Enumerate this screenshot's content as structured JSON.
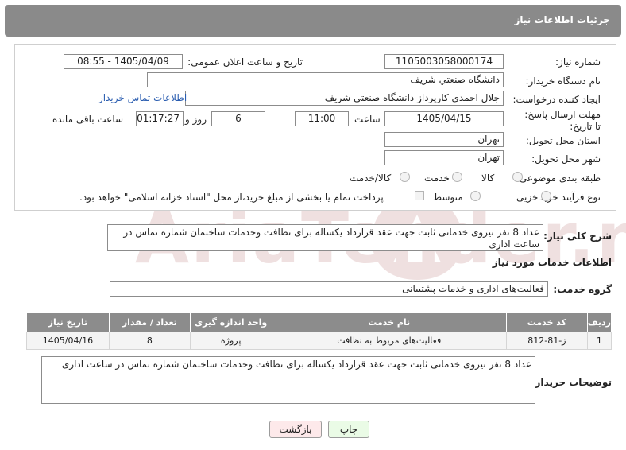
{
  "header": {
    "title": "جزئیات اطلاعات نیاز"
  },
  "form": {
    "need_number": {
      "label": "شماره نیاز:",
      "value": "1105003058000174"
    },
    "announce_datetime": {
      "label": "تاریخ و ساعت اعلان عمومی:",
      "value": "1405/04/09 - 08:55"
    },
    "buyer_org": {
      "label": "نام دستگاه خریدار:",
      "value": "دانشگاه صنعتي شريف"
    },
    "requester": {
      "label": "ایجاد کننده درخواست:",
      "value": "جلال احمدی کارپرداز دانشگاه صنعتي شريف",
      "contact_link": "اطلاعات تماس خریدار"
    },
    "deadline": {
      "label": "مهلت ارسال پاسخ: تا تاریخ:",
      "date": "1405/04/15",
      "time_label": "ساعت",
      "time": "11:00",
      "days": "6",
      "days_label": "روز و",
      "remaining": "01:17:27",
      "remaining_label": "ساعت باقی مانده"
    },
    "province": {
      "label": "استان محل تحویل:",
      "value": "تهران"
    },
    "city": {
      "label": "شهر محل تحویل:",
      "value": "تهران"
    },
    "category": {
      "label": "طبقه بندی موضوعی:",
      "options": [
        "کالا",
        "خدمت",
        "کالا/خدمت"
      ]
    },
    "process_type": {
      "label": "نوع فرآیند خرید :",
      "options": [
        "جزیی",
        "متوسط"
      ],
      "payment_note": "پرداخت تمام یا بخشی از مبلغ خرید،از محل \"اسناد خزانه اسلامی\" خواهد بود."
    }
  },
  "summary": {
    "label": "شرح کلی نیاز:",
    "value": "عداد 8 نفر نیروی خدماتی ثابت جهت عقد قرارداد یکساله برای نظافت وخدمات ساختمان شماره تماس در ساعت اداری"
  },
  "services_section": {
    "title": "اطلاعات خدمات مورد نیاز",
    "group_label": "گروه خدمت:",
    "group_value": "فعالیت‌های اداری و خدمات پشتیبانی",
    "columns": [
      "ردیف",
      "کد خدمت",
      "نام خدمت",
      "واحد اندازه گیری",
      "تعداد / مقدار",
      "تاریخ نیاز"
    ],
    "rows": [
      {
        "index": "1",
        "code": "ز-81-812",
        "name": "فعالیت‌های مربوط به نظافت",
        "unit": "پروژه",
        "qty": "8",
        "date": "1405/04/16"
      }
    ]
  },
  "buyer_notes": {
    "label": "توضیحات خریدار:",
    "value": "عداد 8 نفر نیروی خدماتی ثابت جهت عقد قرارداد یکساله برای نظافت وخدمات ساختمان شماره تماس در ساعت اداری"
  },
  "buttons": {
    "print": "چاپ",
    "back": "بازگشت"
  },
  "watermark": {
    "text": "AriaTender.neT"
  }
}
